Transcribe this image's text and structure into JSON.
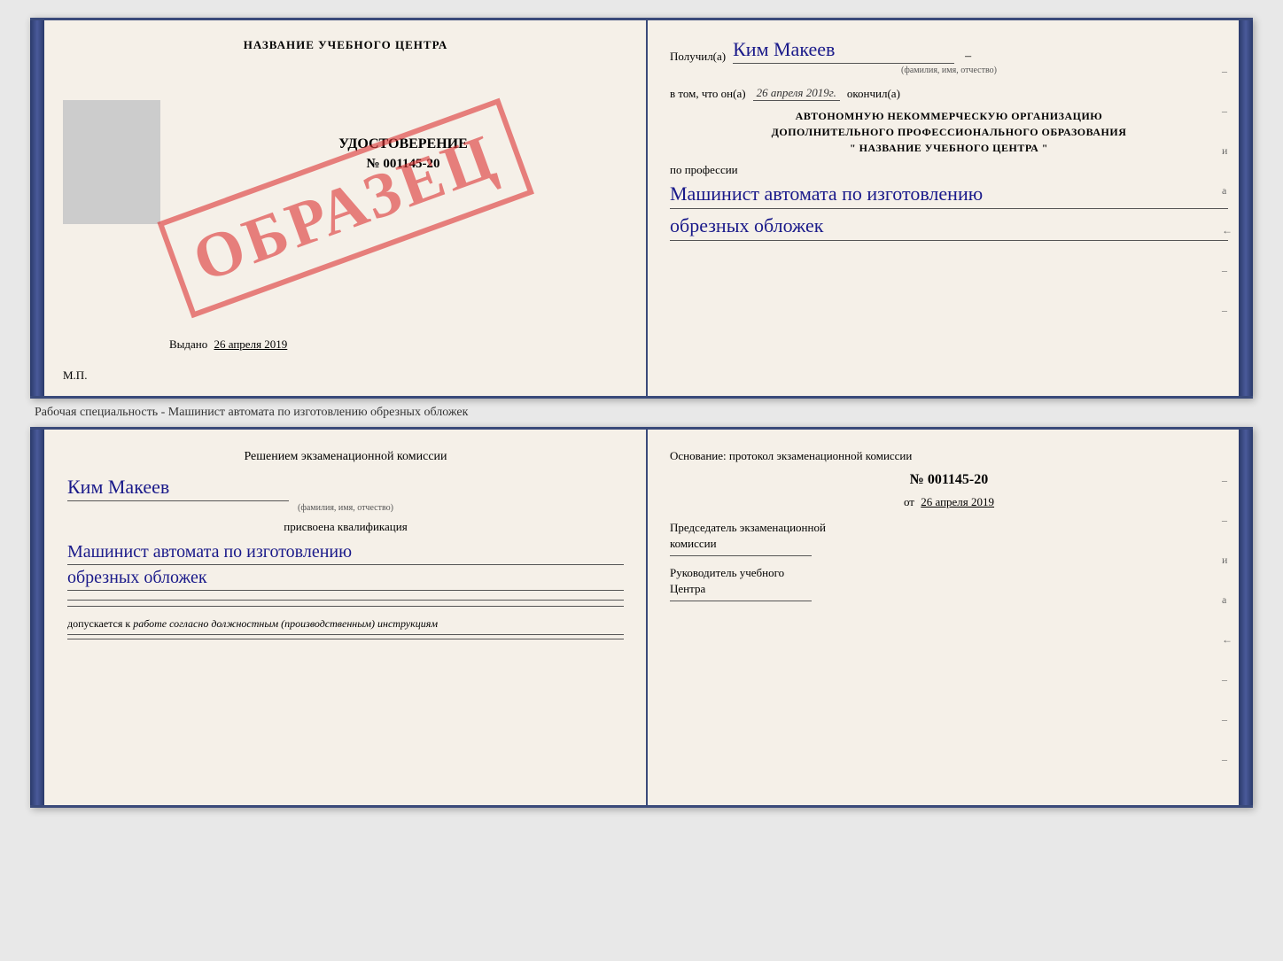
{
  "top_certificate": {
    "left": {
      "title": "НАЗВАНИЕ УЧЕБНОГО ЦЕНТРА",
      "udostoverenie_label": "УДОСТОВЕРЕНИЕ",
      "number": "№ 001145-20",
      "issued_label": "Выдано",
      "issued_date": "26 апреля 2019",
      "mp_label": "М.П."
    },
    "watermark": "ОБРАЗЕЦ",
    "right": {
      "received_label": "Получил(а)",
      "recipient_name": "Ким Макеев",
      "fio_label": "(фамилия, имя, отчество)",
      "dash": "–",
      "in_that_label": "в том, что он(а)",
      "completed_date": "26 апреля 2019г.",
      "completed_label": "окончил(а)",
      "org_line1": "АВТОНОМНУЮ НЕКОММЕРЧЕСКУЮ ОРГАНИЗАЦИЮ",
      "org_line2": "ДОПОЛНИТЕЛЬНОГО ПРОФЕССИОНАЛЬНОГО ОБРАЗОВАНИЯ",
      "org_name": "\" НАЗВАНИЕ УЧЕБНОГО ЦЕНТРА \"",
      "profession_label": "по профессии",
      "profession_handwritten": "Машинист автомата по изготовлению",
      "profession_handwritten2": "обрезных обложек"
    }
  },
  "between_text": "Рабочая специальность - Машинист автомата по изготовлению обрезных обложек",
  "bottom_document": {
    "left": {
      "commission_text": "Решением экзаменационной комиссии",
      "name_handwritten": "Ким Макеев",
      "fio_label": "(фамилия, имя, отчество)",
      "kvalif_label": "присвоена квалификация",
      "kvalif_handwritten": "Машинист автомата по изготовлению",
      "kvalif_handwritten2": "обрезных обложек",
      "allows_label": "допускается к",
      "allows_italic": "работе согласно должностным (производственным) инструкциям"
    },
    "right": {
      "osnov_label": "Основание: протокол экзаменационной комиссии",
      "protocol_num": "№ 001145-20",
      "protocol_date_prefix": "от",
      "protocol_date": "26 апреля 2019",
      "chairman_label": "Председатель экзаменационной",
      "chairman_label2": "комиссии",
      "director_label": "Руководитель учебного",
      "director_label2": "Центра"
    },
    "right_marks": [
      "–",
      "–",
      "и",
      "а",
      "←",
      "–",
      "–",
      "–"
    ]
  }
}
